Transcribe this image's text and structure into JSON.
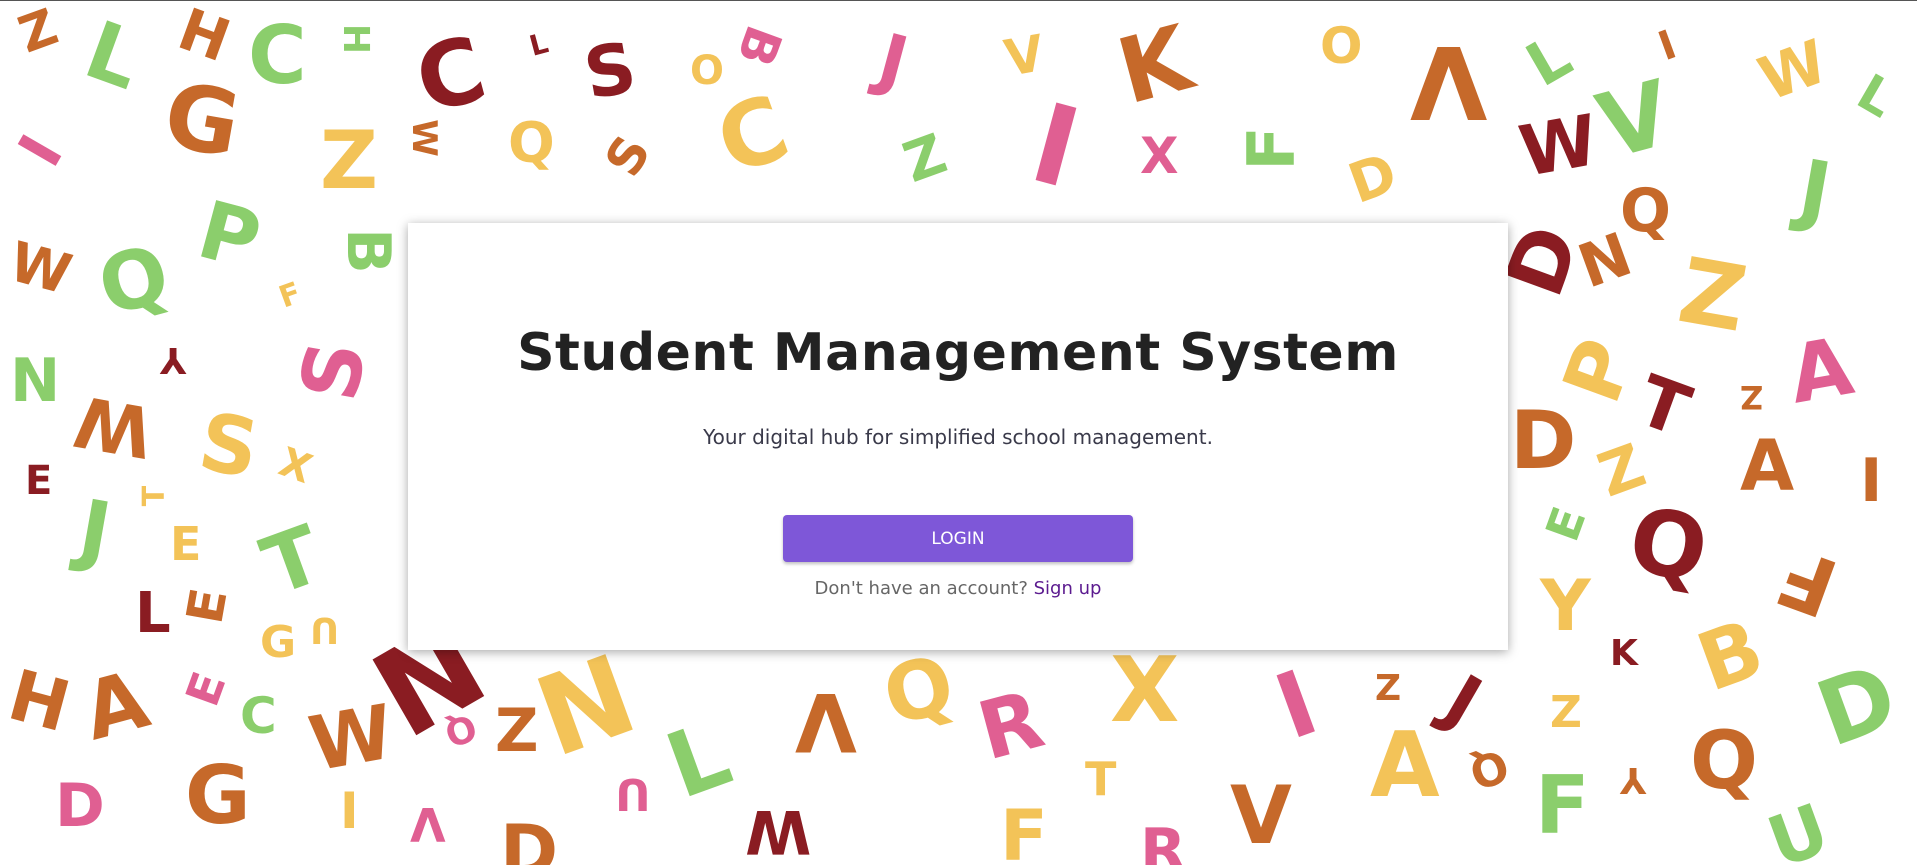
{
  "card": {
    "title": "Student Management System",
    "subtitle": "Your digital hub for simplified school management.",
    "login_label": "LOGIN",
    "signup_prompt": "Don't have an account?",
    "signup_link": "Sign up"
  },
  "colors": {
    "accent": "#7e57d8",
    "link": "#5b1a8f",
    "title": "#222222",
    "background_letter_palette": [
      "#e05f92",
      "#8bce6c",
      "#f3c358",
      "#c6692a",
      "#8a1c22"
    ]
  }
}
